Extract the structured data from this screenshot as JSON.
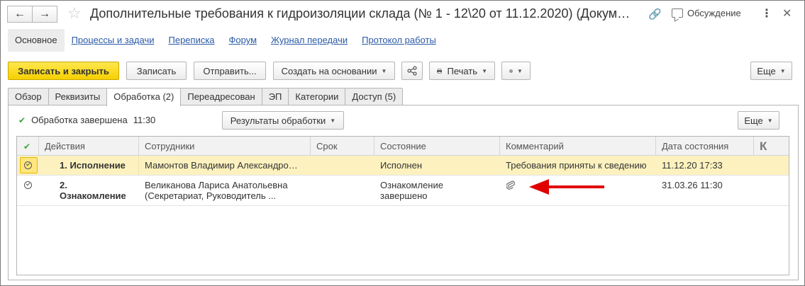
{
  "window": {
    "title": "Дополнительные требования к гидроизоляции склада (№ 1 - 12\\20 от 11.12.2020) (Докум…",
    "discussion_label": "Обсуждение"
  },
  "icons": {
    "back": "arrow-left-icon",
    "forward": "arrow-right-icon",
    "favorite": "star-icon",
    "link": "link-icon",
    "discussion": "chat-icon",
    "more": "more-vertical-icon",
    "close": "close-icon",
    "share": "share-icon",
    "print": "printer-icon",
    "attachment": "paperclip-icon"
  },
  "sections": [
    {
      "label": "Основное"
    },
    {
      "label": "Процессы и задачи"
    },
    {
      "label": "Переписка"
    },
    {
      "label": "Форум"
    },
    {
      "label": "Журнал передачи"
    },
    {
      "label": "Протокол работы"
    }
  ],
  "toolbar": {
    "save_close": "Записать и закрыть",
    "save": "Записать",
    "send": "Отправить...",
    "create_based": "Создать на основании",
    "print": "Печать",
    "more": "Еще"
  },
  "tabs": [
    {
      "label": "Обзор"
    },
    {
      "label": "Реквизиты"
    },
    {
      "label": "Обработка (2)"
    },
    {
      "label": "Переадресован"
    },
    {
      "label": "ЭП"
    },
    {
      "label": "Категории"
    },
    {
      "label": "Доступ (5)"
    }
  ],
  "processing": {
    "status_text": "Обработка завершена",
    "status_time": "11:30",
    "results_label": "Результаты обработки",
    "more_label": "Еще"
  },
  "table": {
    "columns": [
      "Действия",
      "Сотрудники",
      "Срок",
      "Состояние",
      "Комментарий",
      "Дата состояния",
      "К"
    ],
    "rows": [
      {
        "action": "1. Исполнение",
        "employee": "Мамонтов Владимир Александро…",
        "deadline": "",
        "state": "Исполнен",
        "comment": "Требования приняты к сведению",
        "date": "11.12.20 17:33"
      },
      {
        "action_line1": "2.",
        "action_line2": "Ознакомление",
        "employee_line1": "Великанова Лариса Анатольевна",
        "employee_line2": "(Секретариат, Руководитель ...",
        "deadline": "",
        "state_line1": "Ознакомление",
        "state_line2": "завершено",
        "comment": "",
        "date": "31.03.26 11:30"
      }
    ]
  },
  "colors": {
    "primary_button": "#f6d000",
    "link": "#2b5aa6",
    "selected_row": "#fdf2bf",
    "check": "#3aa63a",
    "annotation_arrow": "#e00000"
  }
}
